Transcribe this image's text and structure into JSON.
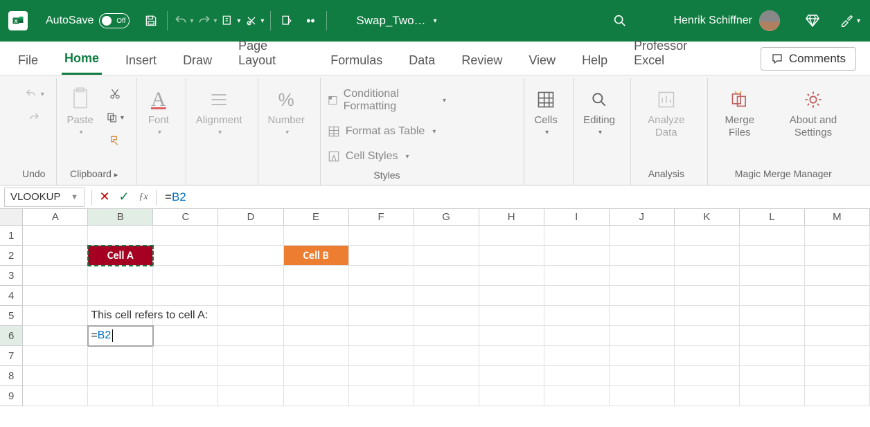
{
  "titlebar": {
    "autosave_label": "AutoSave",
    "autosave_state": "Off",
    "doc_title": "Swap_Two…",
    "user_name": "Henrik Schiffner"
  },
  "tabs": {
    "items": [
      {
        "label": "File"
      },
      {
        "label": "Home",
        "active": true
      },
      {
        "label": "Insert"
      },
      {
        "label": "Draw"
      },
      {
        "label": "Page Layout"
      },
      {
        "label": "Formulas"
      },
      {
        "label": "Data"
      },
      {
        "label": "Review"
      },
      {
        "label": "View"
      },
      {
        "label": "Help"
      },
      {
        "label": "Professor Excel"
      }
    ],
    "comments_label": "Comments"
  },
  "ribbon": {
    "undo_label": "Undo",
    "clipboard": {
      "paste_label": "Paste",
      "group_label": "Clipboard"
    },
    "font": {
      "label": "Font"
    },
    "alignment": {
      "label": "Alignment"
    },
    "number": {
      "label": "Number"
    },
    "styles": {
      "cond_fmt": "Conditional Formatting",
      "table": "Format as Table",
      "cell_styles": "Cell Styles",
      "group_label": "Styles"
    },
    "cells": {
      "label": "Cells"
    },
    "editing": {
      "label": "Editing"
    },
    "analyze": {
      "label": "Analyze Data",
      "group_label": "Analysis"
    },
    "magic": {
      "merge_label": "Merge Files",
      "about_label": "About and Settings",
      "group_label": "Magic Merge Manager"
    }
  },
  "formula_bar": {
    "name_box": "VLOOKUP",
    "formula_prefix": "=",
    "formula_ref": "B2"
  },
  "grid": {
    "columns": [
      "A",
      "B",
      "C",
      "D",
      "E",
      "F",
      "G",
      "H",
      "I",
      "J",
      "K",
      "L",
      "M"
    ],
    "rows": [
      1,
      2,
      3,
      4,
      5,
      6,
      7,
      8,
      9
    ],
    "cell_b2": "Cell A",
    "cell_e2": "Cell B",
    "cell_b5": "This cell refers to cell A:",
    "cell_b6_prefix": "=",
    "cell_b6_ref": "B2",
    "active_row": 6,
    "active_col": "B"
  }
}
